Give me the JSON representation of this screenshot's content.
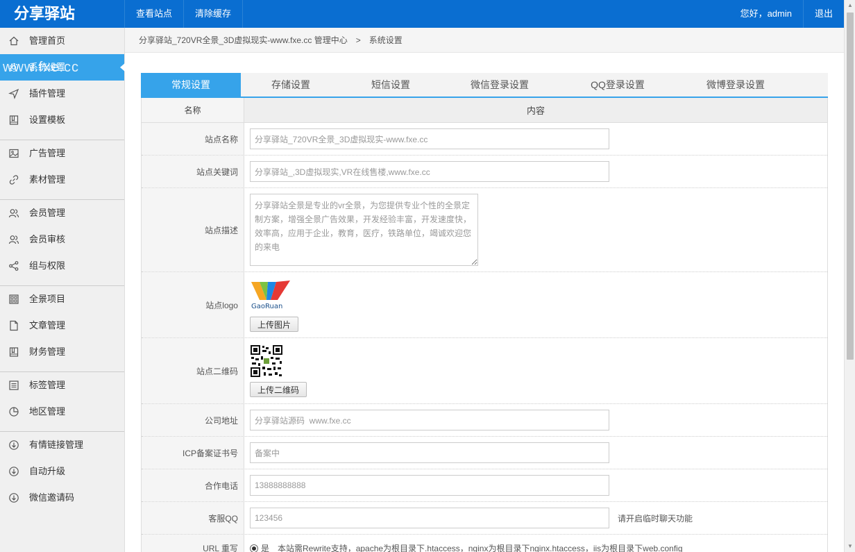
{
  "brand": "分享驿站",
  "topnav": [
    {
      "label": "查看站点"
    },
    {
      "label": "清除缓存"
    }
  ],
  "greeting": "您好，admin",
  "logout": "退出",
  "watermark": "www.fxe.cc",
  "sidebar": {
    "items": [
      {
        "label": "管理首页",
        "icon": "home-icon"
      },
      {
        "label": "系统设置",
        "icon": "gear-icon"
      },
      {
        "label": "插件管理",
        "icon": "send-icon"
      },
      {
        "label": "设置模板",
        "icon": "book-icon"
      },
      {
        "label": "广告管理",
        "icon": "image-icon"
      },
      {
        "label": "素材管理",
        "icon": "link-icon"
      },
      {
        "label": "会员管理",
        "icon": "users-icon"
      },
      {
        "label": "会员审核",
        "icon": "users-icon"
      },
      {
        "label": "组与权限",
        "icon": "share-icon"
      },
      {
        "label": "全景项目",
        "icon": "grid-icon"
      },
      {
        "label": "文章管理",
        "icon": "file-icon"
      },
      {
        "label": "财务管理",
        "icon": "book-icon"
      },
      {
        "label": "标签管理",
        "icon": "list-icon"
      },
      {
        "label": "地区管理",
        "icon": "pie-icon"
      },
      {
        "label": "有情链接管理",
        "icon": "download-circle-icon"
      },
      {
        "label": "自动升级",
        "icon": "download-circle-icon"
      },
      {
        "label": "微信邀请码",
        "icon": "download-circle-icon"
      }
    ]
  },
  "breadcrumb": {
    "root": "分享驿站_720VR全景_3D虚拟现实-www.fxe.cc 管理中心",
    "sep": ">",
    "current": "系统设置"
  },
  "tabs": [
    {
      "label": "常规设置"
    },
    {
      "label": "存储设置"
    },
    {
      "label": "短信设置"
    },
    {
      "label": "微信登录设置"
    },
    {
      "label": "QQ登录设置"
    },
    {
      "label": "微博登录设置"
    }
  ],
  "table": {
    "col_name": "名称",
    "col_content": "内容",
    "site_name": {
      "label": "站点名称",
      "value": "分享驿站_720VR全景_3D虚拟现实-www.fxe.cc"
    },
    "site_keywords": {
      "label": "站点关键词",
      "value": "分享驿站_,3D虚拟现实,VR在线售楼,www.fxe.cc"
    },
    "site_desc": {
      "label": "站点描述",
      "value": "分享驿站全景是专业的vr全景，为您提供专业个性的全景定制方案，增强全景广告效果，开发经验丰富，开发速度快，效率高，应用于企业，教育，医疗，铁路单位，竭诚欢迎您的来电"
    },
    "site_logo": {
      "label": "站点logo",
      "logo_text": "GaoRuan",
      "button": "上传图片"
    },
    "site_qr": {
      "label": "站点二维码",
      "button": "上传二维码"
    },
    "address": {
      "label": "公司地址",
      "value": "分享驿站源码  www.fxe.cc"
    },
    "icp": {
      "label": "ICP备案证书号",
      "value": "备案中"
    },
    "phone": {
      "label": "合作电话",
      "value": "13888888888"
    },
    "qq": {
      "label": "客服QQ",
      "value": "123456",
      "hint": "请开启临时聊天功能"
    },
    "rewrite": {
      "label": "URL 重写",
      "option": "是",
      "hint": "本站需Rewrite支持，apache为根目录下.htaccess，nginx为根目录下nginx.htaccess，iis为根目录下web.config"
    }
  }
}
